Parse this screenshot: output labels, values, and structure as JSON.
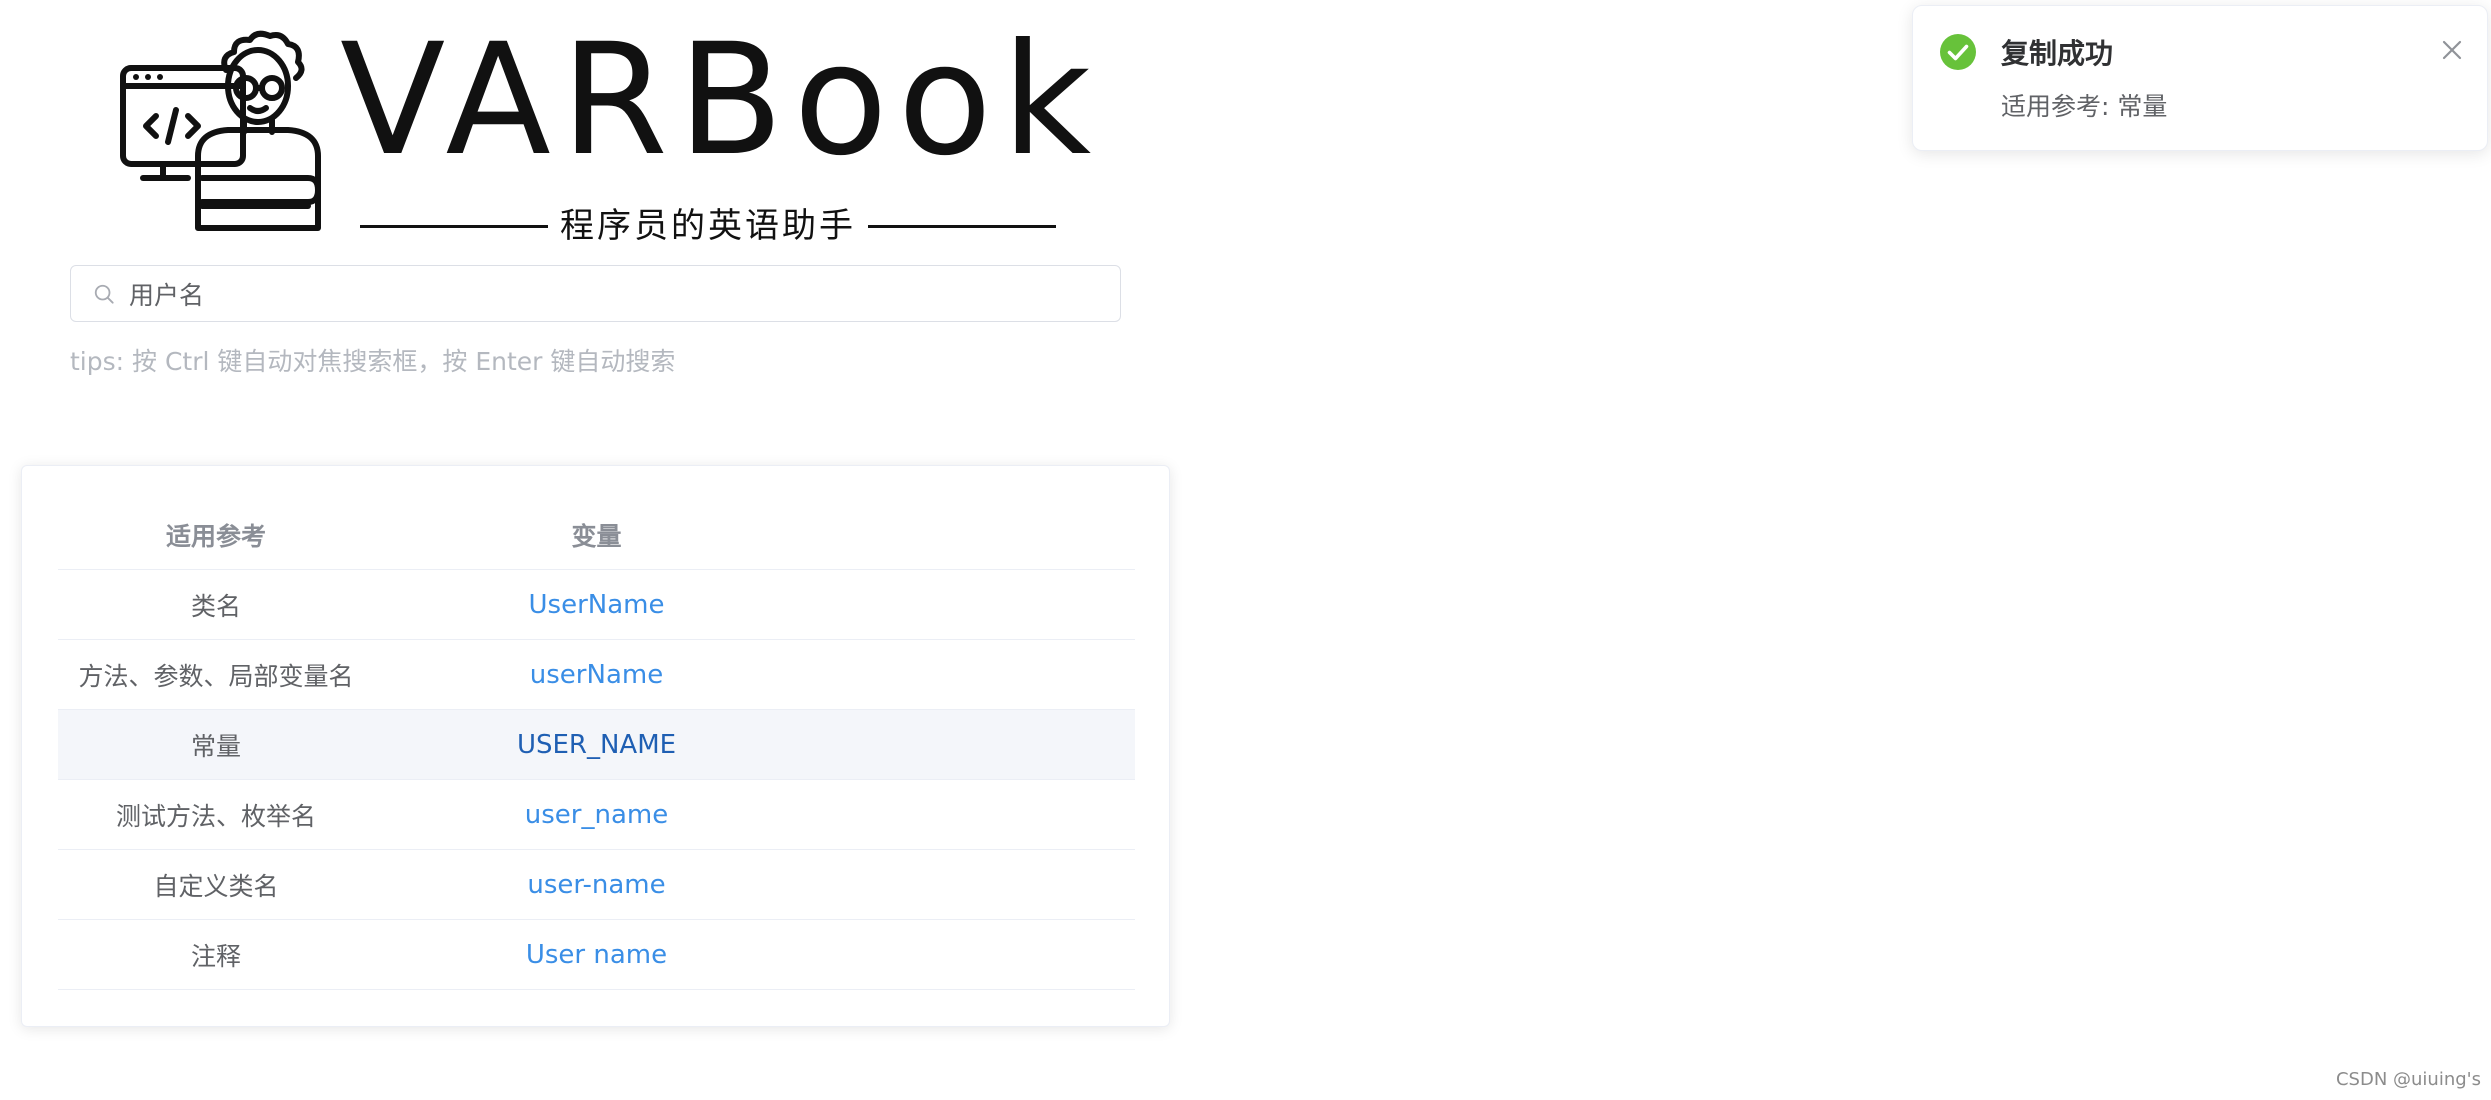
{
  "logo": {
    "title": "VARBook",
    "subtitle": "程序员的英语助手"
  },
  "search": {
    "icon": "search-icon",
    "value": "用户名",
    "placeholder": ""
  },
  "tips": "tips: 按 Ctrl 键自动对焦搜索框，按 Enter 键自动搜索",
  "table": {
    "headers": {
      "reference": "适用参考",
      "variable": "变量"
    },
    "rows": [
      {
        "reference": "类名",
        "variable": "UserName"
      },
      {
        "reference": "方法、参数、局部变量名",
        "variable": "userName"
      },
      {
        "reference": "常量",
        "variable": "USER_NAME"
      },
      {
        "reference": "测试方法、枚举名",
        "variable": "user_name"
      },
      {
        "reference": "自定义类名",
        "variable": "user-name"
      },
      {
        "reference": "注释",
        "variable": "User name"
      }
    ],
    "active_row": 2
  },
  "notification": {
    "icon": "success-check-icon",
    "title": "复制成功",
    "message": "适用参考: 常量",
    "success_color": "#67c23a"
  },
  "watermark": "CSDN @uiuing's",
  "colors": {
    "link": "#3a8ee6",
    "link_active": "#1f5fb3",
    "border": "#ebeef5",
    "muted": "#b4b8bf"
  }
}
